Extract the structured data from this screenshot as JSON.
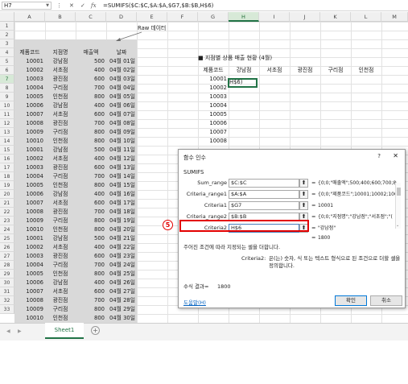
{
  "formula_bar": {
    "name_box": "H7",
    "cancel_glyph": "✕",
    "enter_glyph": "✓",
    "fx_glyph": "fx",
    "formula": "=SUMIFS($C:$C,$A:$A,$G7,$B:$B,H$6)"
  },
  "columns": [
    "A",
    "B",
    "C",
    "D",
    "E",
    "F",
    "G",
    "H",
    "I",
    "J",
    "K",
    "L",
    "M"
  ],
  "rows": [
    "1",
    "2",
    "3",
    "4",
    "5",
    "6",
    "7",
    "8",
    "9",
    "10",
    "11",
    "12",
    "13",
    "14",
    "15",
    "16",
    "17",
    "18",
    "19",
    "20",
    "21",
    "22",
    "23",
    "24",
    "25",
    "26",
    "27",
    "28",
    "29",
    "30",
    "31",
    "32",
    "33"
  ],
  "raw_label": "Raw 데이터",
  "raw_table": {
    "headers": [
      "제품코드",
      "지점명",
      "매출액",
      "날짜"
    ],
    "rows": [
      [
        "10001",
        "강남점",
        "500",
        "04월 01일"
      ],
      [
        "10002",
        "서초점",
        "400",
        "04월 02일"
      ],
      [
        "10003",
        "광진점",
        "600",
        "04월 03일"
      ],
      [
        "10004",
        "구리점",
        "700",
        "04월 04일"
      ],
      [
        "10005",
        "인천점",
        "800",
        "04월 05일"
      ],
      [
        "10006",
        "강남점",
        "400",
        "04월 06일"
      ],
      [
        "10007",
        "서초점",
        "600",
        "04월 07일"
      ],
      [
        "10008",
        "광진점",
        "700",
        "04월 08일"
      ],
      [
        "10009",
        "구리점",
        "800",
        "04월 09일"
      ],
      [
        "10010",
        "인천점",
        "800",
        "04월 10일"
      ],
      [
        "10001",
        "강남점",
        "500",
        "04월 11일"
      ],
      [
        "10002",
        "서초점",
        "400",
        "04월 12일"
      ],
      [
        "10003",
        "광진점",
        "600",
        "04월 13일"
      ],
      [
        "10004",
        "구리점",
        "700",
        "04월 14일"
      ],
      [
        "10005",
        "인천점",
        "800",
        "04월 15일"
      ],
      [
        "10006",
        "강남점",
        "400",
        "04월 16일"
      ],
      [
        "10007",
        "서초점",
        "600",
        "04월 17일"
      ],
      [
        "10008",
        "광진점",
        "700",
        "04월 18일"
      ],
      [
        "10009",
        "구리점",
        "800",
        "04월 19일"
      ],
      [
        "10010",
        "인천점",
        "800",
        "04월 20일"
      ],
      [
        "10001",
        "강남점",
        "500",
        "04월 21일"
      ],
      [
        "10002",
        "서초점",
        "400",
        "04월 22일"
      ],
      [
        "10003",
        "광진점",
        "600",
        "04월 23일"
      ],
      [
        "10004",
        "구리점",
        "700",
        "04월 24일"
      ],
      [
        "10005",
        "인천점",
        "800",
        "04월 25일"
      ],
      [
        "10006",
        "강남점",
        "400",
        "04월 26일"
      ],
      [
        "10007",
        "서초점",
        "600",
        "04월 27일"
      ],
      [
        "10008",
        "광진점",
        "700",
        "04월 28일"
      ],
      [
        "10009",
        "구리점",
        "800",
        "04월 29일"
      ],
      [
        "10010",
        "인천점",
        "800",
        "04월 30일"
      ]
    ]
  },
  "summary": {
    "title": "■ 지점별 상품 매출 현황 (4월)",
    "headers": [
      "제품코드",
      "강남점",
      "서초점",
      "광진점",
      "구리점",
      "인천점"
    ],
    "codes": [
      "10001",
      "10002",
      "10003",
      "10004",
      "10005",
      "10006",
      "10007",
      "10008"
    ],
    "active_cell_value": "H$6)"
  },
  "dialog": {
    "title": "함수 인수",
    "help_glyph": "?",
    "close_glyph": "✕",
    "function_name": "SUMIFS",
    "args": [
      {
        "label": "Sum_range",
        "input": "$C:$C",
        "result": "{0;0;\"매출액\";500;400;600;700;8("
      },
      {
        "label": "Criteria_range1",
        "input": "$A:$A",
        "result": "{0;0;\"제품코드\";10001;10002;100("
      },
      {
        "label": "Criteria1",
        "input": "$G7",
        "result": "10001"
      },
      {
        "label": "Criteria_range2",
        "input": "$B:$B",
        "result": "{0;0;\"지점명\";\"강남점\";\"서초점\";\"("
      },
      {
        "label": "Criteria2",
        "input": "H$6",
        "result": "\"강남점\""
      }
    ],
    "picker_glyph": "⬆",
    "eq": "=",
    "total_result": "1800",
    "description": "주어진 조건에 따라 지정되는 셀을 더합니다.",
    "arg_help_label": "Criteria2:",
    "arg_help_text_1": "은(는) 숫자, 식 또는 텍스트 형식으로 된 조건으로 더할 셀을",
    "arg_help_text_2": "정의합니다.",
    "formula_result_label": "수식 결과=",
    "formula_result_value": "1800",
    "help_link": "도움말(H)",
    "ok_label": "확인",
    "cancel_label": "취소"
  },
  "annotation_number": "5",
  "sheet_tab": "Sheet1",
  "sheet_prev_glyph": "◀",
  "sheet_next_glyph": "▶",
  "add_sheet_glyph": "+"
}
